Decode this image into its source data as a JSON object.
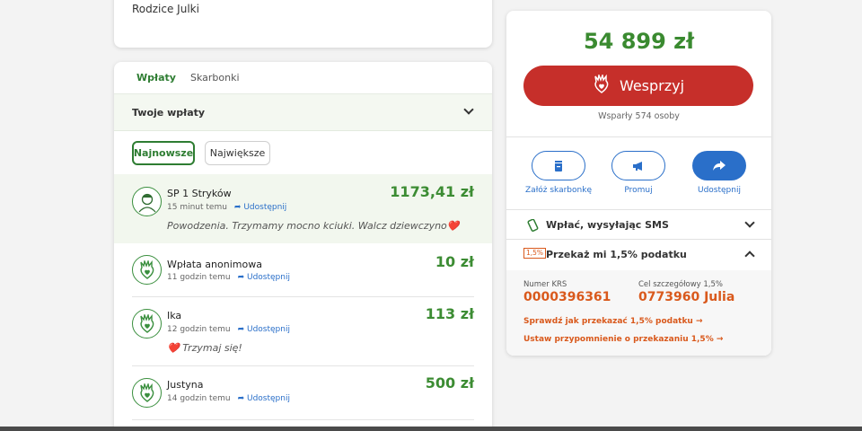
{
  "top_card": {
    "text": "Rodzice Julki"
  },
  "donations": {
    "tabs": [
      {
        "label": "Wpłaty"
      },
      {
        "label": "Skarbonki"
      }
    ],
    "your_donations_label": "Twoje wpłaty",
    "filters": {
      "newest": "Najnowsze",
      "largest": "Największe"
    },
    "share_label": "Udostępnij",
    "items": [
      {
        "name": "SP 1 Stryków",
        "time": "15 minut temu",
        "amount": "1173,41 zł",
        "message": "Powodzenia. Trzymamy mocno kciuki. Walcz dziewczyno❤️"
      },
      {
        "name": "Wpłata anonimowa",
        "time": "11 godzin temu",
        "amount": "10 zł",
        "message": ""
      },
      {
        "name": "Ika",
        "time": "12 godzin temu",
        "amount": "113 zł",
        "message": "❤️ Trzymaj się!"
      },
      {
        "name": "Justyna",
        "time": "14 godzin temu",
        "amount": "500 zł",
        "message": ""
      }
    ]
  },
  "support": {
    "amount": "54 899 zł",
    "button_label": "Wesprzyj",
    "supporters": "Wsparły 574 osoby",
    "actions": [
      {
        "label": "Załóż skarbonkę"
      },
      {
        "label": "Promuj"
      },
      {
        "label": "Udostępnij"
      }
    ],
    "sms_label": "Wpłać, wysyłając SMS",
    "tax_label": "Przekaż mi 1,5% podatku",
    "tax_badge": "1,5%",
    "krs_label": "Numer KRS",
    "krs_value": "0000396361",
    "goal_label": "Cel szczegółowy 1,5%",
    "goal_value": "0773960 Julia",
    "link1": "Sprawdź jak przekazać 1,5% podatku",
    "link2": "Ustaw przypomnienie o przekazaniu 1,5%"
  },
  "colors": {
    "green": "#3a8a30",
    "red": "#c62f2a",
    "blue": "#2a6fc9",
    "orange": "#d9591c"
  }
}
